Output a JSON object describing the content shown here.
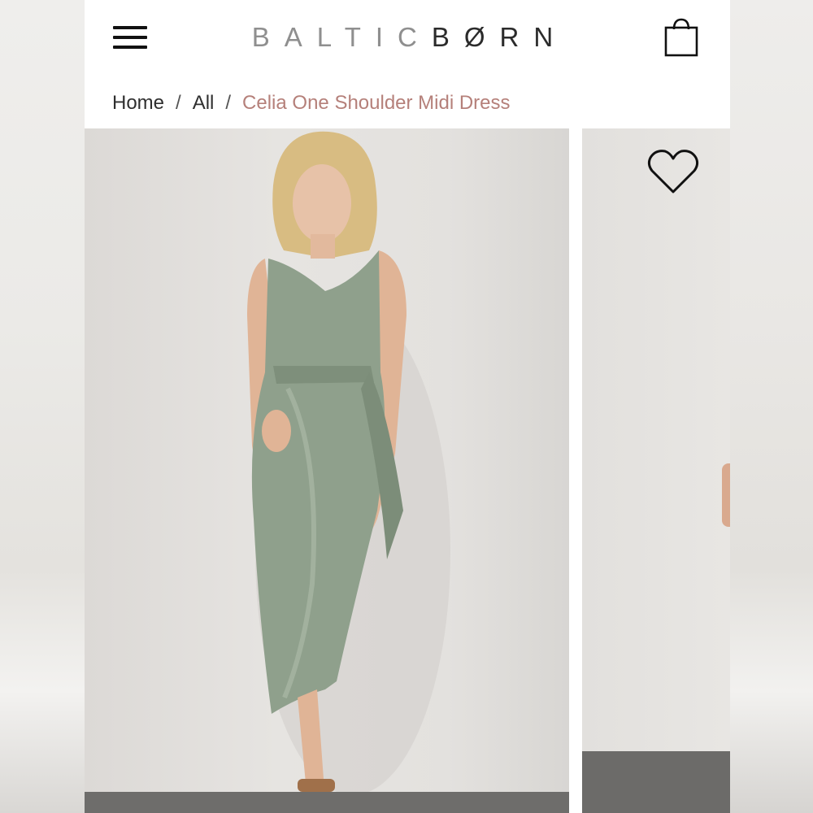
{
  "header": {
    "logo_part_a": "BALTIC",
    "logo_part_b": "BØRN",
    "menu_icon": "hamburger-menu-icon",
    "cart_icon": "shopping-bag-icon"
  },
  "breadcrumb": {
    "items": [
      {
        "label": "Home"
      },
      {
        "label": "All"
      }
    ],
    "separator": "/",
    "current": "Celia One Shoulder Midi Dress"
  },
  "gallery": {
    "wishlist_icon": "heart-icon",
    "current_color": "#b5807a"
  },
  "colors": {
    "accent": "#b5807a",
    "text": "#2f2f2f",
    "logo_light": "#8f8f8f",
    "logo_dark": "#2b2b2b",
    "dress": "#8fa08c"
  }
}
